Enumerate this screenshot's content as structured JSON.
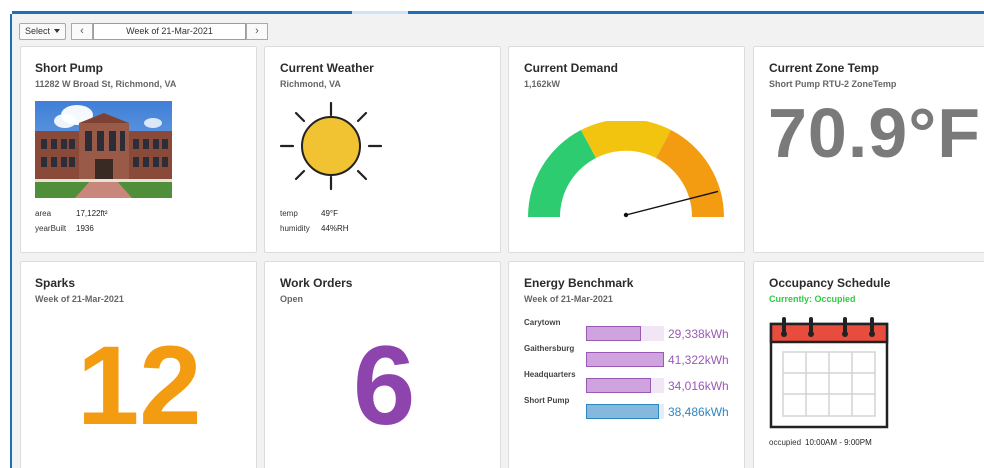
{
  "toolbar": {
    "select_label": "Select",
    "prev_icon": "chevron-left-icon",
    "next_icon": "chevron-right-icon",
    "week_label": "Week of 21-Mar-2021"
  },
  "site": {
    "title": "Short Pump",
    "address": "11282 W Broad St, Richmond, VA",
    "area_key": "area",
    "area_value": "17,122ft²",
    "year_key": "yearBuilt",
    "year_value": "1936"
  },
  "weather": {
    "title": "Current Weather",
    "location": "Richmond, VA",
    "icon": "sun-icon",
    "temp_key": "temp",
    "temp_value": "49°F",
    "humidity_key": "humidity",
    "humidity_value": "44%RH"
  },
  "demand": {
    "title": "Current Demand",
    "value": "1,162kW",
    "gauge_fraction": 0.92,
    "colors": {
      "green": "#2ecc71",
      "yellow": "#f2c40f",
      "orange": "#f39c12"
    }
  },
  "zone": {
    "title": "Current Zone Temp",
    "subtitle": "Short Pump RTU-2 ZoneTemp",
    "value": "70.9°F"
  },
  "sparks": {
    "title": "Sparks",
    "subtitle": "Week of 21-Mar-2021",
    "value": "12",
    "color": "#f39c12"
  },
  "work_orders": {
    "title": "Work Orders",
    "subtitle": "Open",
    "value": "6",
    "color": "#8e44ad"
  },
  "benchmark": {
    "title": "Energy Benchmark",
    "subtitle": "Week of 21-Mar-2021",
    "rows": [
      {
        "label": "Carytown",
        "value": "29,338kWh",
        "fraction": 0.71,
        "color": "#9b59b6"
      },
      {
        "label": "Gaithersburg",
        "value": "41,322kWh",
        "fraction": 1.0,
        "color": "#9b59b6"
      },
      {
        "label": "Headquarters",
        "value": "34,016kWh",
        "fraction": 0.83,
        "color": "#9b59b6"
      },
      {
        "label": "Short Pump",
        "value": "38,486kWh",
        "fraction": 0.93,
        "color": "#2e86c1"
      }
    ]
  },
  "occupancy": {
    "title": "Occupancy Schedule",
    "status": "Currently: Occupied",
    "icon": "calendar-icon",
    "occupied_key": "occupied",
    "occupied_value": "10:00AM - 9:00PM"
  }
}
